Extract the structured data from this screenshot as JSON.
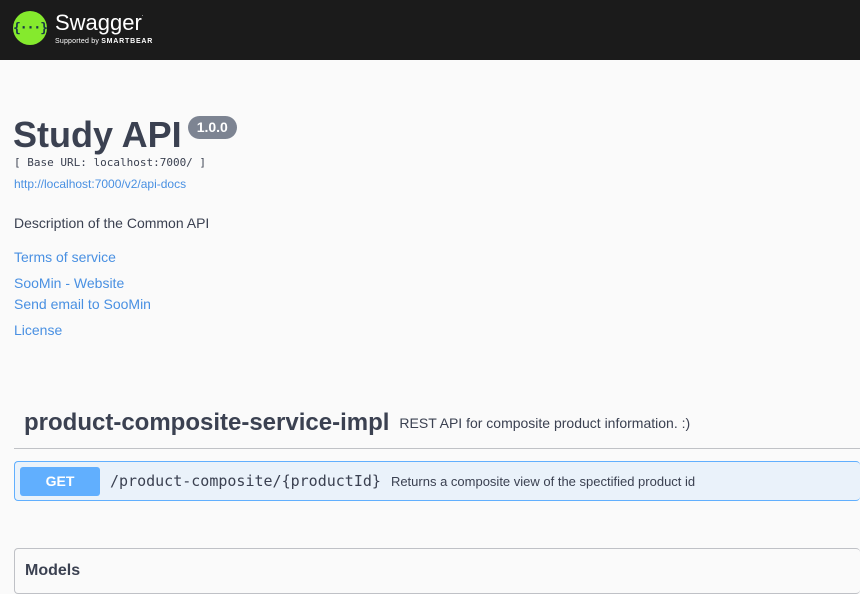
{
  "topbar": {
    "logo_icon_text": "{···}",
    "logo_name": "Swagger",
    "logo_sub_prefix": "Supported by",
    "logo_sub_brand": "SMARTBEAR"
  },
  "info": {
    "title": "Study API",
    "version": "1.0.0",
    "base_url": "[ Base URL: localhost:7000/ ]",
    "api_docs_link": "http://localhost:7000/v2/api-docs",
    "description": "Description of the Common API",
    "terms": "Terms of service",
    "website": "SooMin - Website",
    "email": "Send email to SooMin",
    "license": "License"
  },
  "tag": {
    "name": "product-composite-service-impl",
    "description": "REST API for composite product information. :)"
  },
  "operation": {
    "method": "GET",
    "path": "/product-composite/{productId}",
    "summary": "Returns a composite view of the spectified product id"
  },
  "models": {
    "title": "Models"
  },
  "colors": {
    "topbar": "#1b1b1b",
    "logo_green": "#85ea2d",
    "get_blue": "#61affe",
    "link": "#4990e2"
  }
}
